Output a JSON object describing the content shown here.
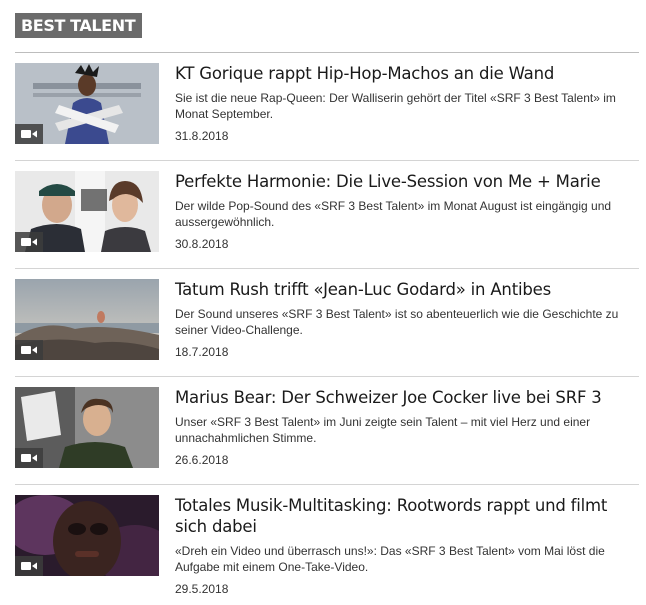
{
  "section": {
    "label": "BEST TALENT"
  },
  "icons": {
    "video": "video-camera-icon"
  },
  "articles": [
    {
      "title": "KT Gorique rappt Hip-Hop-Machos an die Wand",
      "teaser": "Sie ist die neue Rap-Queen: Der Walliserin gehört der Titel «SRF 3 Best Talent» im Monat September.",
      "date": "31.8.2018"
    },
    {
      "title": "Perfekte Harmonie: Die Live-Session von Me + Marie",
      "teaser": "Der wilde Pop-Sound des «SRF 3 Best Talent» im Monat August ist eingängig und aussergewöhnlich.",
      "date": "30.8.2018"
    },
    {
      "title": "Tatum Rush trifft «Jean-Luc Godard» in Antibes",
      "teaser": "Der Sound unseres «SRF 3 Best Talent» ist so abenteuerlich wie die Geschichte zu seiner Video-Challenge.",
      "date": "18.7.2018"
    },
    {
      "title": "Marius Bear: Der Schweizer Joe Cocker live bei SRF 3",
      "teaser": "Unser «SRF 3 Best Talent» im Juni zeigte sein Talent – mit viel Herz und einer unnachahmlichen Stimme.",
      "date": "26.6.2018"
    },
    {
      "title": "Totales Musik-Multitasking: Rootwords rappt und filmt sich dabei",
      "teaser": "«Dreh ein Video und überrasch uns!»: Das «SRF 3 Best Talent» vom Mai löst die Aufgabe mit einem One-Take-Video.",
      "date": "29.5.2018"
    }
  ]
}
